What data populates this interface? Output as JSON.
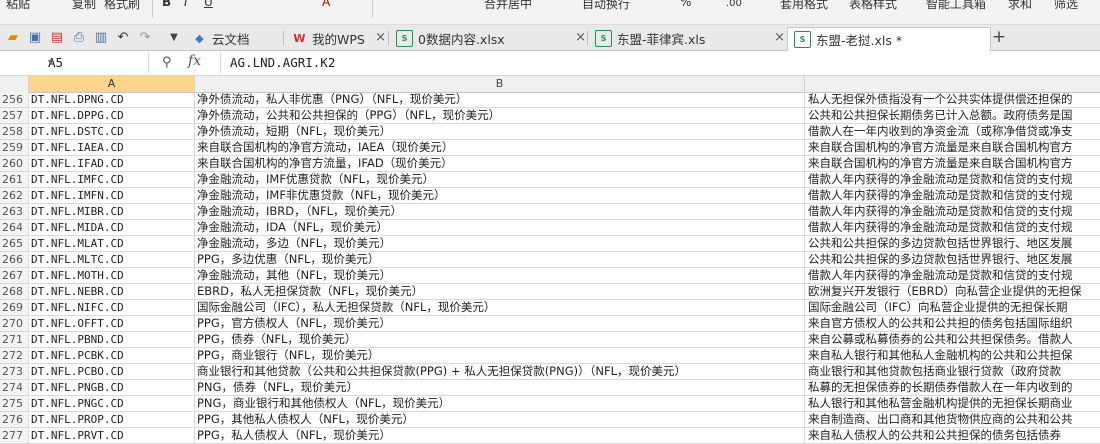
{
  "ribbon": {
    "items": [
      "粘贴",
      "复制",
      "格式刷",
      "B",
      "I",
      "U",
      "A",
      "合并居中",
      "自动换行",
      "%",
      ".00",
      "表格样式",
      "套用格式",
      "智能工具箱",
      "求和",
      "筛选"
    ]
  },
  "toolbar": {
    "tabs": [
      {
        "label": "云文档",
        "icon": "cloud-icon",
        "close": ""
      },
      {
        "label": "我的WPS",
        "icon": "wps-logo-icon",
        "close": "×"
      },
      {
        "label": "0数据内容.xlsx",
        "icon": "document-icon",
        "close": "×"
      },
      {
        "label": "东盟-菲律宾.xls",
        "icon": "spreadsheet-icon",
        "close": "×"
      },
      {
        "label": "东盟-老挝.xls *",
        "icon": "spreadsheet-icon",
        "close": ""
      }
    ],
    "add_tab": "+"
  },
  "formula_bar": {
    "cell_ref": "A5",
    "fx": "fx",
    "content": "AG.LND.AGRI.K2"
  },
  "columns": [
    "A",
    "B"
  ],
  "rows": [
    {
      "n": "256",
      "a": "DT.NFL.DPNG.CD",
      "b": "净外债流动，私人非优惠（PNG）（NFL，现价美元）",
      "c": "私人无担保外债指没有一个公共实体提供偿还担保的"
    },
    {
      "n": "257",
      "a": "DT.NFL.DPPG.CD",
      "b": "净外债流动，公共和公共担保的（PPG）（NFL，现价美元）",
      "c": "公共和公共担保长期债务已计入总额。政府债务是国"
    },
    {
      "n": "258",
      "a": "DT.NFL.DSTC.CD",
      "b": "净外债流动，短期（NFL，现价美元）",
      "c": "借款人在一年内收到的净资金流（或称净借贷或净支"
    },
    {
      "n": "259",
      "a": "DT.NFL.IAEA.CD",
      "b": "来自联合国机构的净官方流动，IAEA（现价美元）",
      "c": "来自联合国机构的净官方流量是来自联合国机构官方"
    },
    {
      "n": "260",
      "a": "DT.NFL.IFAD.CD",
      "b": "来自联合国机构的净官方流量，IFAD（现价美元）",
      "c": "来自联合国机构的净官方流量是来自联合国机构官方"
    },
    {
      "n": "261",
      "a": "DT.NFL.IMFC.CD",
      "b": "净金融流动，IMF优惠贷款（NFL，现价美元）",
      "c": "借款人年内获得的净金融流动是贷款和信贷的支付规"
    },
    {
      "n": "262",
      "a": "DT.NFL.IMFN.CD",
      "b": "净金融流动，IMF非优惠贷款（NFL，现价美元）",
      "c": "借款人年内获得的净金融流动是贷款和信贷的支付规"
    },
    {
      "n": "263",
      "a": "DT.NFL.MIBR.CD",
      "b": "净金融流动，IBRD，（NFL，现价美元）",
      "c": "借款人年内获得的净金融流动是贷款和信贷的支付规"
    },
    {
      "n": "264",
      "a": "DT.NFL.MIDA.CD",
      "b": "净金融流动，IDA（NFL，现价美元）",
      "c": "借款人年内获得的净金融流动是贷款和信贷的支付规"
    },
    {
      "n": "265",
      "a": "DT.NFL.MLAT.CD",
      "b": "净金融流动，多边（NFL，现价美元）",
      "c": "公共和公共担保的多边贷款包括世界银行、地区发展"
    },
    {
      "n": "266",
      "a": "DT.NFL.MLTC.CD",
      "b": "PPG，多边优惠（NFL，现价美元）",
      "c": "公共和公共担保的多边贷款包括世界银行、地区发展"
    },
    {
      "n": "267",
      "a": "DT.NFL.MOTH.CD",
      "b": "净金融流动，其他（NFL，现价美元）",
      "c": "借款人年内获得的净金融流动是贷款和信贷的支付规"
    },
    {
      "n": "268",
      "a": "DT.NFL.NEBR.CD",
      "b": "EBRD，私人无担保贷款（NFL，现价美元）",
      "c": "欧洲复兴开发银行（EBRD）向私营企业提供的无担保"
    },
    {
      "n": "269",
      "a": "DT.NFL.NIFC.CD",
      "b": "国际金融公司（IFC），私人无担保贷款（NFL，现价美元）",
      "c": "国际金融公司（IFC）向私营企业提供的无担保长期"
    },
    {
      "n": "270",
      "a": "DT.NFL.OFFT.CD",
      "b": "PPG，官方债权人（NFL，现价美元）",
      "c": "来自官方债权人的公共和公共担的债务包括国际组织"
    },
    {
      "n": "271",
      "a": "DT.NFL.PBND.CD",
      "b": "PPG，债券（NFL，现价美元）",
      "c": "来自公募或私募债券的公共和公共担保债务。借款人"
    },
    {
      "n": "272",
      "a": "DT.NFL.PCBK.CD",
      "b": "PPG，商业银行（NFL，现价美元）",
      "c": "来自私人银行和其他私人金融机构的公共和公共担保"
    },
    {
      "n": "273",
      "a": "DT.NFL.PCBO.CD",
      "b": "商业银行和其他贷款（公共和公共担保贷款(PPG) + 私人无担保贷款(PNG)）（NFL，现价美元）",
      "c": "商业银行和其他贷款包括商业银行贷款（政府贷款"
    },
    {
      "n": "274",
      "a": "DT.NFL.PNGB.CD",
      "b": "PNG，债券（NFL，现价美元）",
      "c": "私募的无担保债券的长期债券借款人在一年内收到的"
    },
    {
      "n": "275",
      "a": "DT.NFL.PNGC.CD",
      "b": "PNG，商业银行和其他债权人（NFL，现价美元）",
      "c": "私人银行和其他私营金融机构提供的无担保长期商业"
    },
    {
      "n": "276",
      "a": "DT.NFL.PROP.CD",
      "b": "PPG，其他私人债权人（NFL，现价美元）",
      "c": "来自制造商、出口商和其他货物供应商的公共和公共"
    },
    {
      "n": "277",
      "a": "DT.NFL.PRVT.CD",
      "b": "PPG，私人债权人（NFL，现价美元）",
      "c": "来自私人债权人的公共和公共担保的债务包括债券"
    }
  ]
}
